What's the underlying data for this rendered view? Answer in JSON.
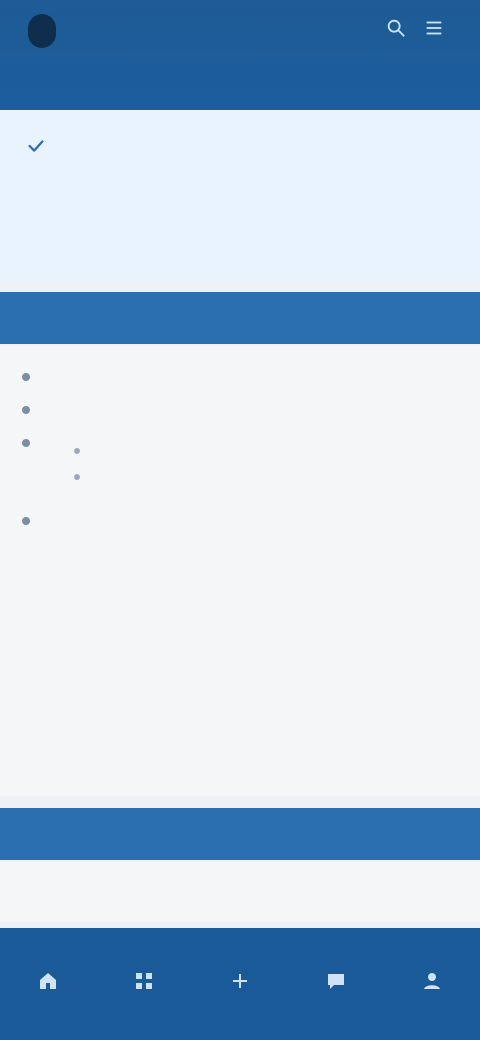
{
  "header": {
    "title": "",
    "subtitle": ""
  },
  "banner": {
    "message": "",
    "subtitle": "",
    "link_text": "",
    "action_text": ""
  },
  "sections": {
    "section1_title": "",
    "section2_title": ""
  },
  "list": {
    "bullets": [
      {
        "text": ""
      },
      {
        "text": ""
      },
      {
        "text": "",
        "subitems": [
          {
            "text": ""
          },
          {
            "text": ""
          }
        ]
      },
      {
        "text": ""
      }
    ]
  },
  "section2": {
    "body_text": ""
  },
  "nav": {
    "items": [
      {
        "label": ""
      },
      {
        "label": ""
      },
      {
        "label": ""
      },
      {
        "label": ""
      },
      {
        "label": ""
      }
    ]
  },
  "colors": {
    "header_bg": "#1f5b95",
    "banner_bg": "#e8f3fe",
    "section_bg": "#2b6fb0",
    "nav_bg": "#1b5a98"
  }
}
